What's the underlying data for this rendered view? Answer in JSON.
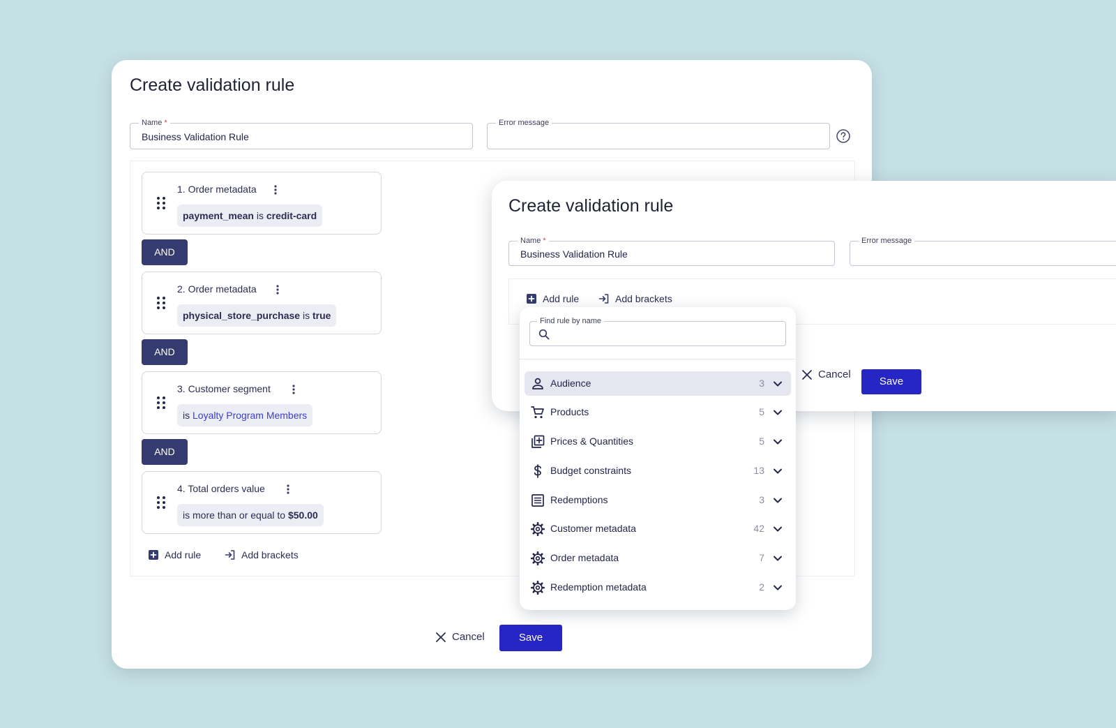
{
  "main_dialog": {
    "title": "Create validation rule",
    "name_label": "Name",
    "required_mark": "*",
    "name_value": "Business Validation Rule",
    "error_label": "Error message",
    "error_value": "",
    "rules": [
      {
        "title": "1. Order metadata",
        "chip_bold": "payment_mean",
        "chip_mid": " is ",
        "chip_bold2": "credit-card"
      },
      {
        "title": "2. Order metadata",
        "chip_bold": "physical_store_purchase",
        "chip_mid": " is ",
        "chip_bold2": "true"
      },
      {
        "title": "3. Customer segment",
        "chip_prefix": "is ",
        "chip_link": "Loyalty Program Members"
      },
      {
        "title": "4. Total orders value",
        "chip_prefix": "is more than or equal to ",
        "chip_bold2": "$50.00"
      }
    ],
    "and_label": "AND",
    "add_rule": "Add rule",
    "add_brackets": "Add brackets",
    "cancel": "Cancel",
    "save": "Save"
  },
  "front_dialog": {
    "title": "Create validation rule",
    "name_label": "Name",
    "required_mark": "*",
    "name_value": "Business Validation Rule",
    "error_label": "Error message",
    "add_rule": "Add rule",
    "add_brackets": "Add brackets",
    "cancel": "Cancel",
    "save": "Save"
  },
  "popover": {
    "search_label": "Find rule by name",
    "search_value": "",
    "categories": [
      {
        "label": "Audience",
        "count": "3",
        "icon": "person-icon"
      },
      {
        "label": "Products",
        "count": "5",
        "icon": "cart-icon"
      },
      {
        "label": "Prices & Quantities",
        "count": "5",
        "icon": "library-add-icon"
      },
      {
        "label": "Budget constraints",
        "count": "13",
        "icon": "dollar-icon"
      },
      {
        "label": "Redemptions",
        "count": "3",
        "icon": "list-icon"
      },
      {
        "label": "Customer metadata",
        "count": "42",
        "icon": "gear-icon"
      },
      {
        "label": "Order metadata",
        "count": "7",
        "icon": "gear-icon"
      },
      {
        "label": "Redemption metadata",
        "count": "2",
        "icon": "gear-icon"
      }
    ]
  },
  "colors": {
    "background": "#c6e1e5",
    "primary": "#2626c4",
    "and_badge": "#343b6e",
    "chip_bg": "#ececf5",
    "link": "#3a3fc4"
  }
}
